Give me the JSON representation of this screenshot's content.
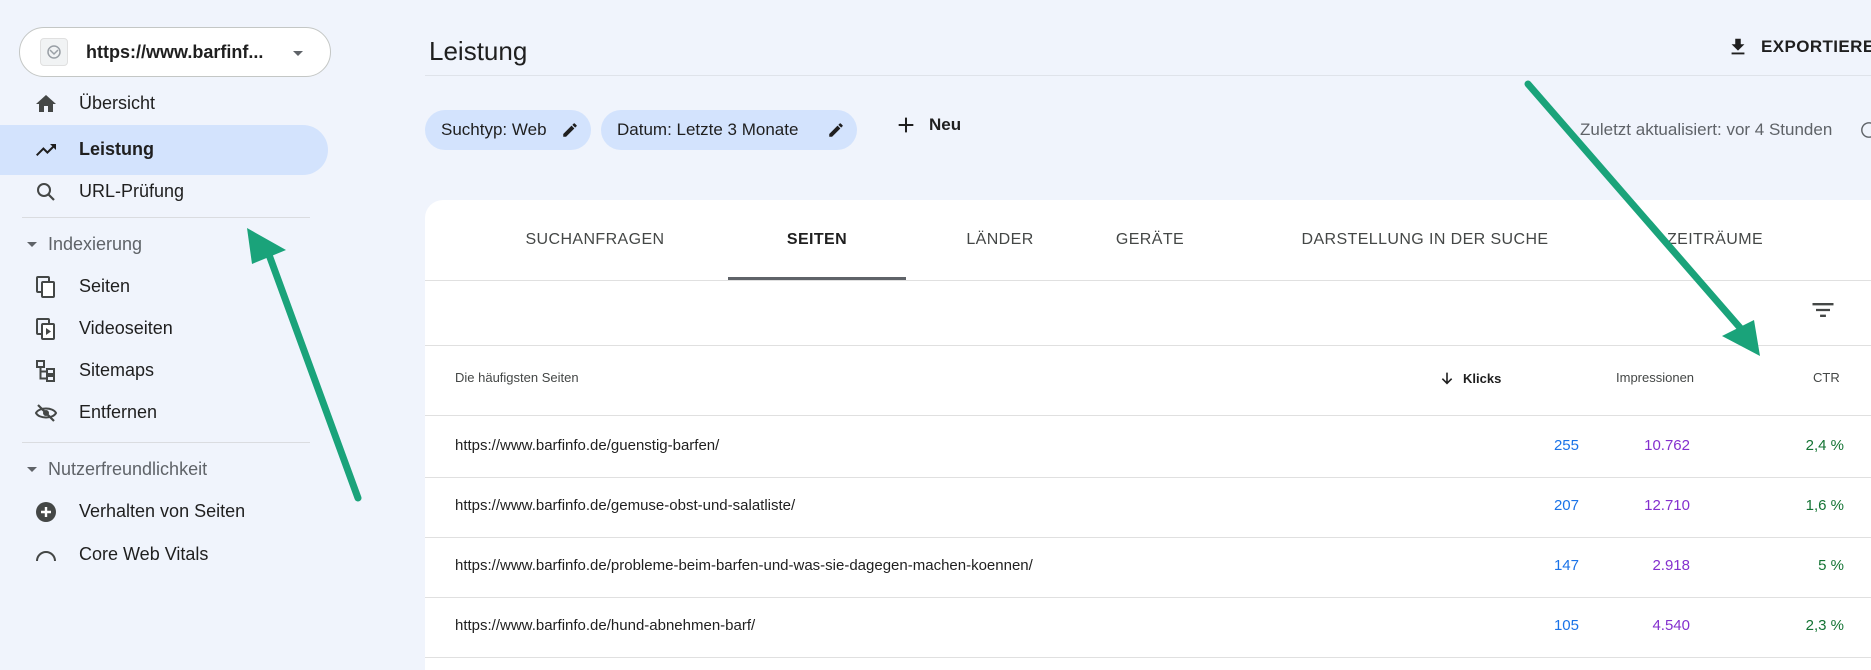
{
  "colors": {
    "accent_chip": "#d3e3fd",
    "clicks": "#1a73e8",
    "impressions": "#8430ce",
    "ctr": "#137333",
    "annotation_arrow": "#1aa37a"
  },
  "sidebar": {
    "property_url": "https://www.barfinf...",
    "items": [
      {
        "label": "Übersicht",
        "icon": "home-icon"
      },
      {
        "label": "Leistung",
        "icon": "trending-up-icon",
        "active": true
      },
      {
        "label": "URL-Prüfung",
        "icon": "search-icon"
      }
    ],
    "sections": [
      {
        "label": "Indexierung",
        "items": [
          {
            "label": "Seiten",
            "icon": "pages-icon"
          },
          {
            "label": "Videoseiten",
            "icon": "video-pages-icon"
          },
          {
            "label": "Sitemaps",
            "icon": "sitemap-icon"
          },
          {
            "label": "Entfernen",
            "icon": "eye-off-icon"
          }
        ]
      },
      {
        "label": "Nutzerfreundlichkeit",
        "items": [
          {
            "label": "Verhalten von Seiten",
            "icon": "plus-circle-icon"
          },
          {
            "label": "Core Web Vitals",
            "icon": "gauge-icon"
          }
        ]
      }
    ]
  },
  "header": {
    "title": "Leistung",
    "export_label": "EXPORTIEREN"
  },
  "filters": {
    "chips": [
      {
        "label": "Suchtyp: Web"
      },
      {
        "label": "Datum: Letzte 3 Monate"
      }
    ],
    "new_label": "Neu",
    "updated": "Zuletzt aktualisiert: vor 4 Stunden"
  },
  "tabs": [
    {
      "label": "SUCHANFRAGEN"
    },
    {
      "label": "SEITEN",
      "active": true
    },
    {
      "label": "LÄNDER"
    },
    {
      "label": "GERÄTE"
    },
    {
      "label": "DARSTELLUNG IN DER SUCHE"
    },
    {
      "label": "ZEITRÄUME"
    }
  ],
  "table": {
    "headers": {
      "page": "Die häufigsten Seiten",
      "clicks": "Klicks",
      "impressions": "Impressionen",
      "ctr": "CTR"
    },
    "rows": [
      {
        "url": "https://www.barfinfo.de/guenstig-barfen/",
        "clicks": "255",
        "impressions": "10.762",
        "ctr": "2,4 %"
      },
      {
        "url": "https://www.barfinfo.de/gemuse-obst-und-salatliste/",
        "clicks": "207",
        "impressions": "12.710",
        "ctr": "1,6 %"
      },
      {
        "url": "https://www.barfinfo.de/probleme-beim-barfen-und-was-sie-dagegen-machen-koennen/",
        "clicks": "147",
        "impressions": "2.918",
        "ctr": "5 %"
      },
      {
        "url": "https://www.barfinfo.de/hund-abnehmen-barf/",
        "clicks": "105",
        "impressions": "4.540",
        "ctr": "2,3 %"
      }
    ]
  }
}
